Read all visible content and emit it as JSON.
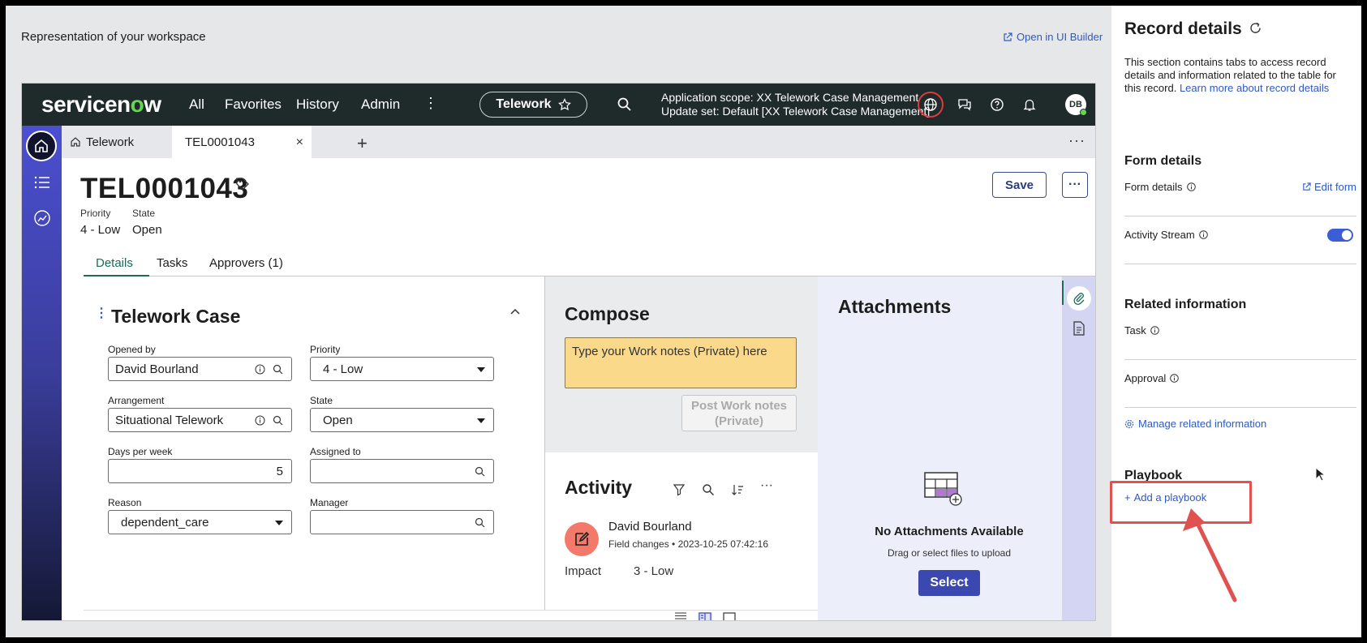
{
  "canvas": {
    "title": "Representation of your workspace",
    "open_builder": "Open in UI Builder"
  },
  "app": {
    "logo_pre": "servicen",
    "logo_o": "o",
    "logo_post": "w",
    "nav": [
      "All",
      "Favorites",
      "History",
      "Admin"
    ],
    "scope_name": "Telework",
    "scope_line1": "Application scope: XX Telework Case Management",
    "scope_line2": "Update set: Default [XX Telework Case Management]",
    "avatar": "DB",
    "tabs": {
      "home": "Telework",
      "record": "TEL0001043"
    },
    "record": {
      "number": "TEL0001043",
      "priority_label": "Priority",
      "priority_value": "4 - Low",
      "state_label": "State",
      "state_value": "Open",
      "save": "Save"
    },
    "form_tabs": [
      "Details",
      "Tasks",
      "Approvers (1)"
    ],
    "form": {
      "title": "Telework Case",
      "opened_by_label": "Opened by",
      "opened_by": "David Bourland",
      "priority_label": "Priority",
      "priority": "4 - Low",
      "arrangement_label": "Arrangement",
      "arrangement": "Situational Telework",
      "state_label": "State",
      "state": "Open",
      "days_label": "Days per week",
      "days": "5",
      "assigned_label": "Assigned to",
      "assigned": "",
      "reason_label": "Reason",
      "reason": "dependent_care",
      "manager_label": "Manager",
      "manager": ""
    },
    "compose": {
      "title": "Compose",
      "placeholder": "Type your Work notes (Private) here",
      "post": "Post Work notes (Private)"
    },
    "activity": {
      "title": "Activity",
      "name": "David Bourland",
      "sub": "Field changes • 2023-10-25 07:42:16",
      "field": "Impact",
      "value": "3 - Low"
    },
    "attachments": {
      "title": "Attachments",
      "none": "No Attachments Available",
      "hint": "Drag or select files to upload",
      "select": "Select"
    }
  },
  "panel": {
    "title": "Record details",
    "desc": "This section contains tabs to access record details and information related to the table for this record.",
    "learn_more": "Learn more about record details",
    "form_details_heading": "Form details",
    "form_details_label": "Form details",
    "edit_form": "Edit form",
    "activity_stream": "Activity Stream",
    "activity_stream_on": true,
    "related_heading": "Related information",
    "task": "Task",
    "approval": "Approval",
    "manage": "Manage related information",
    "playbook_heading": "Playbook",
    "add_playbook": "Add a playbook"
  },
  "colors": {
    "accent": "#2d59c8",
    "topbar": "#1f2a2b",
    "highlight": "#e0524f",
    "compose": "#fbd98a"
  }
}
